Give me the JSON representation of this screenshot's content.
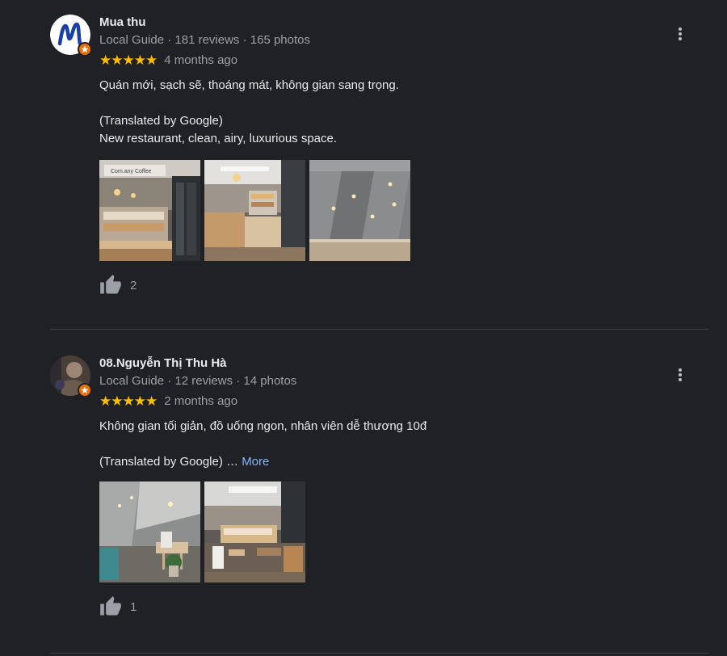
{
  "reviews": [
    {
      "author": "Mua thu",
      "guide_label": "Local Guide",
      "stats": " · 181 reviews · 165 photos",
      "stars": "★★★★★",
      "rating": 5,
      "time": "4 months ago",
      "text": "Quán mới, sạch sẽ, thoáng mát, không gian sang trọng.",
      "translated_label": "(Translated by Google)",
      "translated_text": "New restaurant, clean, airy, luxurious space.",
      "photo_sign_text": "Com.any Coffee",
      "likes": "2"
    },
    {
      "author": "08.Nguyễn Thị Thu Hà",
      "guide_label": "Local Guide",
      "stats": " · 12 reviews · 14 photos",
      "stars": "★★★★★",
      "rating": 5,
      "time": "2 months ago",
      "text": "Không gian tối giản, đồ uống ngon, nhân viên dễ thương 10đ",
      "translated_label": "(Translated by Google) … ",
      "more_label": "More",
      "likes": "1"
    }
  ],
  "icons": {
    "menu": "more-vert-icon",
    "like": "thumb-up-icon",
    "badge": "local-guide-star-icon"
  },
  "colors": {
    "background": "#202124",
    "star": "#fbbc04",
    "link": "#8ab4f8",
    "badge": "#e8710a"
  }
}
